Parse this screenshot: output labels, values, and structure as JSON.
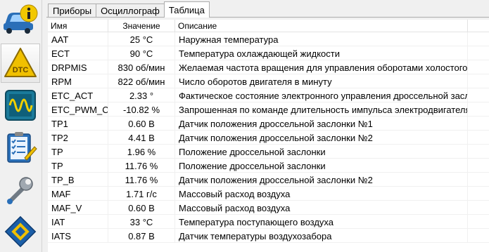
{
  "sidebar": {
    "items": [
      {
        "name": "car-info"
      },
      {
        "name": "dtc"
      },
      {
        "name": "oscilloscope"
      },
      {
        "name": "checklist"
      },
      {
        "name": "wrench"
      },
      {
        "name": "chip"
      }
    ],
    "dtc_label": "DTC"
  },
  "tabs": [
    {
      "label": "Приборы"
    },
    {
      "label": "Осциллограф"
    },
    {
      "label": "Таблица",
      "active": true
    }
  ],
  "table": {
    "columns": {
      "name": "Имя",
      "value": "Значение",
      "description": "Описание"
    },
    "rows": [
      {
        "name": "AAT",
        "value": "25 °C",
        "description": "Наружная температура"
      },
      {
        "name": "ECT",
        "value": "90 °C",
        "description": "Температура охлаждающей жидкости"
      },
      {
        "name": "DRPMIS",
        "value": "830 об/мин",
        "description": "Желаемая частота вращения для управления оборотами холостого хо"
      },
      {
        "name": "RPM",
        "value": "822 об/мин",
        "description": "Число оборотов двигателя в минуту"
      },
      {
        "name": "ETC_ACT",
        "value": "2.33 °",
        "description": "Фактическое состояние электронного управления дроссельной заслонк"
      },
      {
        "name": "ETC_PWM_CM",
        "value": "-10.82 %",
        "description": "Запрошенная по команде длительность импульса электродвигателя эл"
      },
      {
        "name": "TP1",
        "value": "0.60 В",
        "description": "Датчик положения дроссельной заслонки №1"
      },
      {
        "name": "TP2",
        "value": "4.41 В",
        "description": "Датчик положения дроссельной заслонки №2"
      },
      {
        "name": "TP",
        "value": "1.96 %",
        "description": "Положение дроссельной заслонки"
      },
      {
        "name": "TP",
        "value": "11.76 %",
        "description": "Положение дроссельной заслонки"
      },
      {
        "name": "TP_B",
        "value": "11.76 %",
        "description": "Датчик положения дроссельной заслонки №2"
      },
      {
        "name": "MAF",
        "value": "1.71 г/с",
        "description": "Массовый расход воздуха"
      },
      {
        "name": "MAF_V",
        "value": "0.60 В",
        "description": "Массовый расход воздуха"
      },
      {
        "name": "IAT",
        "value": "33 °C",
        "description": "Температура поступающего воздуха"
      },
      {
        "name": "IATS",
        "value": "0.87 В",
        "description": "Датчик температуры воздухозабора"
      }
    ]
  },
  "colors": {
    "car_body": "#2a6fb8",
    "info_badge": "#f2c800",
    "dtc_triangle": "#f0c000",
    "scope_bg": "#1a7a9a",
    "scope_wave": "#f0d000",
    "chip_blue": "#1c5fa8",
    "chip_yellow": "#f0c000"
  }
}
